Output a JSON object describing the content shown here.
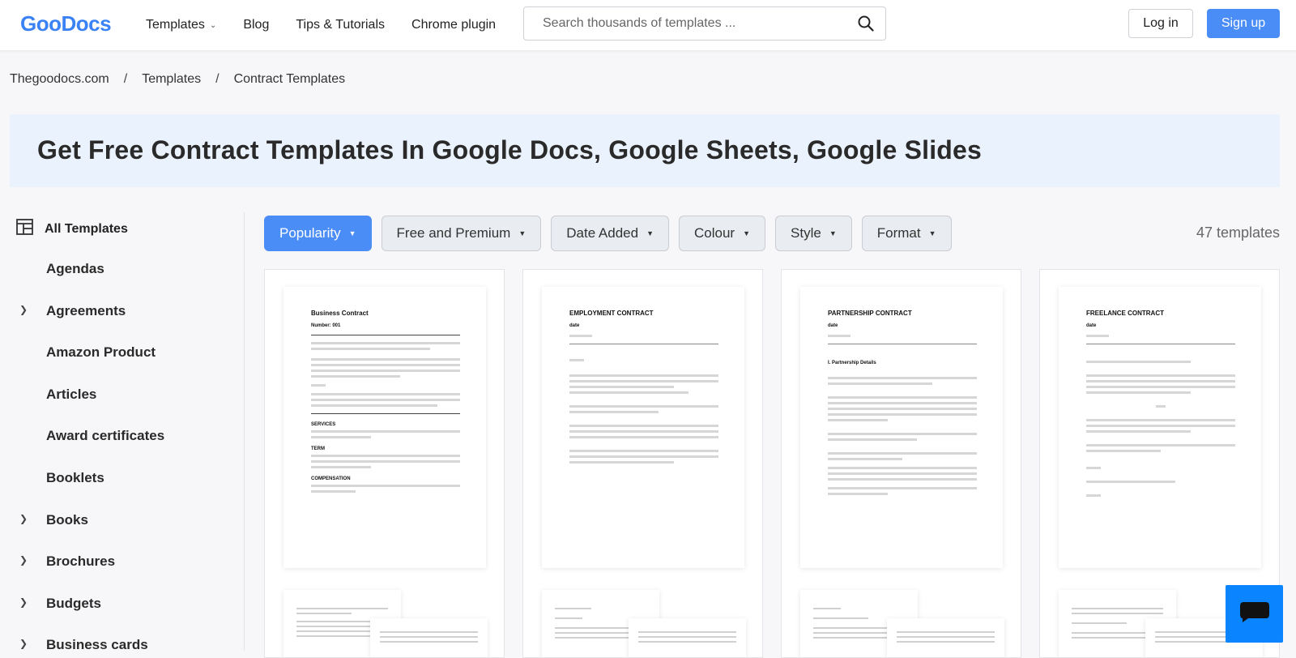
{
  "header": {
    "logo": "GooDocs",
    "nav": [
      "Templates",
      "Blog",
      "Tips & Tutorials",
      "Chrome plugin"
    ],
    "search_placeholder": "Search thousands of templates ...",
    "login": "Log in",
    "signup": "Sign up"
  },
  "breadcrumb": [
    "Thegoodocs.com",
    "Templates",
    "Contract Templates"
  ],
  "hero_title": "Get Free Contract Templates In Google Docs, Google Sheets, Google Slides",
  "sidebar": {
    "all": "All Templates",
    "items": [
      {
        "label": "Agendas",
        "expandable": false
      },
      {
        "label": "Agreements",
        "expandable": true
      },
      {
        "label": "Amazon Product",
        "expandable": false
      },
      {
        "label": "Articles",
        "expandable": false
      },
      {
        "label": "Award certificates",
        "expandable": false
      },
      {
        "label": "Booklets",
        "expandable": false
      },
      {
        "label": "Books",
        "expandable": true
      },
      {
        "label": "Brochures",
        "expandable": true
      },
      {
        "label": "Budgets",
        "expandable": true
      },
      {
        "label": "Business cards",
        "expandable": true
      }
    ]
  },
  "filters": [
    "Popularity",
    "Free and Premium",
    "Date Added",
    "Colour",
    "Style",
    "Format"
  ],
  "template_count": "47 templates",
  "cards": [
    {
      "title": "Business Contract",
      "subtitle": "Number: 001"
    },
    {
      "title": "EMPLOYMENT CONTRACT",
      "subtitle": "date"
    },
    {
      "title": "PARTNERSHIP CONTRACT",
      "subtitle": "date"
    },
    {
      "title": "FREELANCE CONTRACT",
      "subtitle": "date"
    }
  ],
  "colors": {
    "brand": "#4a8df6",
    "hero_bg": "#eaf2fd",
    "chat": "#0a84ff"
  }
}
